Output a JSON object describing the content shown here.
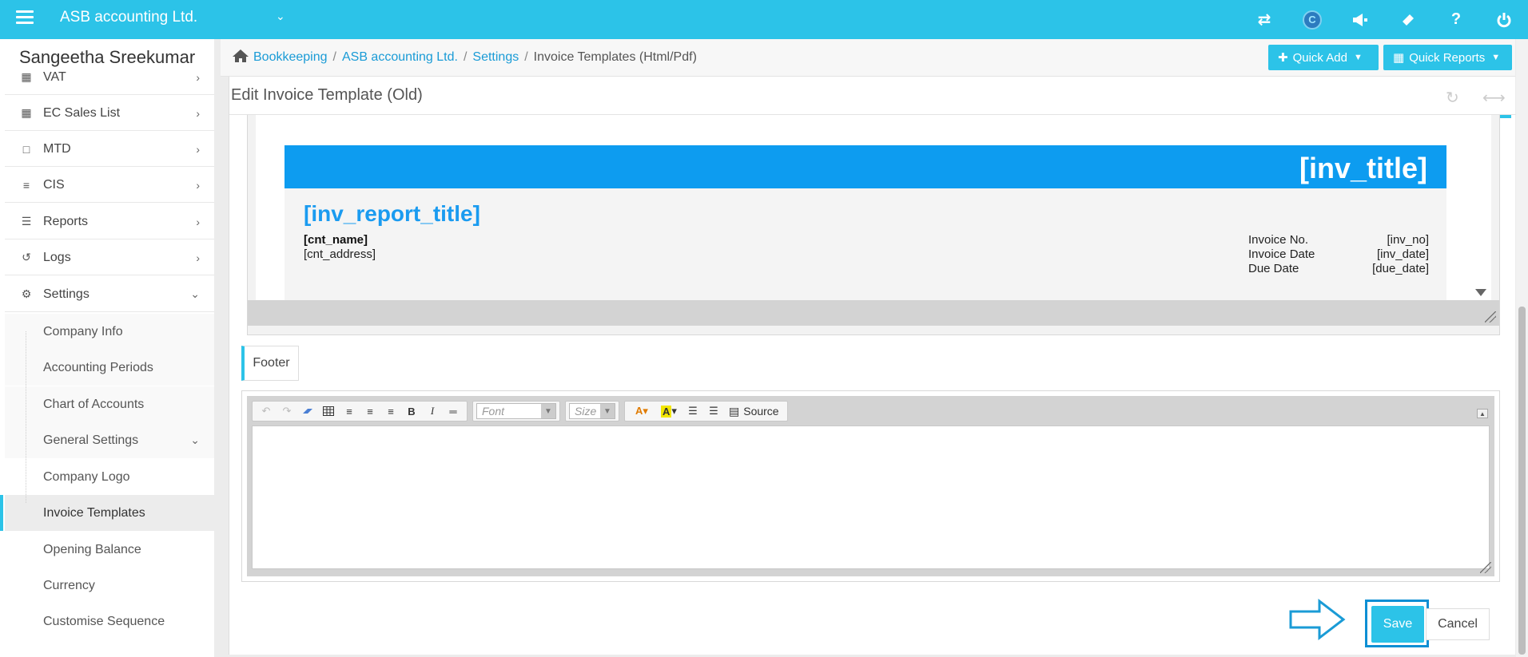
{
  "topbar": {
    "company": "ASB accounting Ltd.",
    "c_badge": "C",
    "icons": [
      "transfer-icon",
      "currency-c-icon",
      "megaphone-icon",
      "ticket-icon",
      "help-icon",
      "power-icon"
    ],
    "help_glyph": "?",
    "bg_color": "#2cc3e8"
  },
  "sidebar": {
    "user": "Sangeetha Sreekumar",
    "items": [
      {
        "label": "VAT",
        "icon": "calculator-icon"
      },
      {
        "label": "EC Sales List",
        "icon": "calculator-icon"
      },
      {
        "label": "MTD",
        "icon": "calendar-icon"
      },
      {
        "label": "CIS",
        "icon": "indent-icon"
      },
      {
        "label": "Reports",
        "icon": "list-icon"
      },
      {
        "label": "Logs",
        "icon": "history-icon"
      },
      {
        "label": "Settings",
        "icon": "cogs-icon"
      }
    ],
    "sub_items": [
      {
        "label": "Company Info"
      },
      {
        "label": "Accounting Periods"
      },
      {
        "label": "Chart of Accounts"
      },
      {
        "label": "General Settings"
      },
      {
        "label": "Company Logo"
      },
      {
        "label": "Invoice Templates"
      },
      {
        "label": "Opening Balance"
      },
      {
        "label": "Currency"
      },
      {
        "label": "Customise Sequence"
      }
    ],
    "active": "Invoice Templates"
  },
  "breadcrumb": {
    "items": [
      "Bookkeeping",
      "ASB accounting Ltd.",
      "Settings"
    ],
    "current": "Invoice Templates (Html/Pdf)",
    "separator": "/"
  },
  "quick": {
    "add": "Quick Add",
    "reports": "Quick Reports"
  },
  "panel": {
    "title": "Edit Invoice Template (Old)"
  },
  "template": {
    "inv_title": "[inv_title]",
    "report_title": "[inv_report_title]",
    "cnt_name": "[cnt_name]",
    "cnt_address": "[cnt_address]",
    "meta": [
      {
        "label": "Invoice No.",
        "value": "[inv_no]"
      },
      {
        "label": "Invoice Date",
        "value": "[inv_date]"
      },
      {
        "label": "Due Date",
        "value": "[due_date]"
      }
    ],
    "header_color": "#0d9cf0"
  },
  "footer_section": {
    "label": "Footer",
    "toolbar": {
      "font_placeholder": "Font",
      "size_placeholder": "Size",
      "source_label": "Source"
    }
  },
  "actions": {
    "save": "Save",
    "cancel": "Cancel"
  }
}
